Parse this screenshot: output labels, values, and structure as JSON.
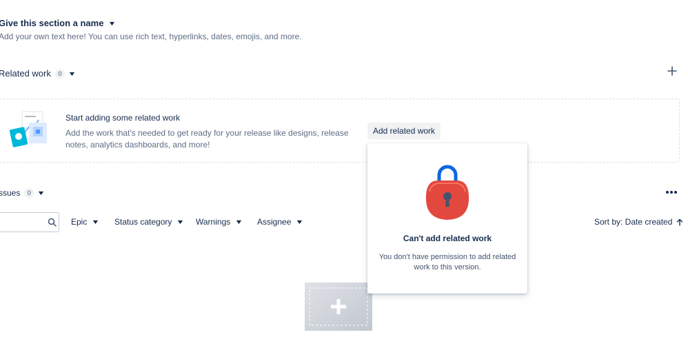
{
  "section": {
    "title": "Give this section a name",
    "description": "Add your own text here! You can use rich text, hyperlinks, dates, emojis, and more."
  },
  "related_work": {
    "title": "Related work",
    "count": "0",
    "empty_title": "Start adding some related work",
    "empty_description": "Add the work that's needed to get ready for your release like designs, release notes, analytics dashboards, and more!",
    "add_button": "Add related work"
  },
  "issues": {
    "title": "ssues",
    "count": "0"
  },
  "filters": {
    "search_placeholder": "",
    "epic": "Epic",
    "status_category": "Status category",
    "warnings": "Warnings",
    "assignee": "Assignee",
    "sort": "Sort by: Date created"
  },
  "popover": {
    "title": "Can't add related work",
    "description": "You don't have permission to add related work to this version."
  },
  "icons": {
    "expand": "chevron-down-icon",
    "add": "plus-icon",
    "more": "more-horizontal-icon",
    "search": "search-icon",
    "sort": "arrow-up-icon",
    "lock": "lock-icon"
  },
  "colors": {
    "text_primary": "#172b4d",
    "text_subtle": "#5e6c84",
    "lock_body": "#e2483d",
    "lock_shackle": "#0c66e4"
  }
}
